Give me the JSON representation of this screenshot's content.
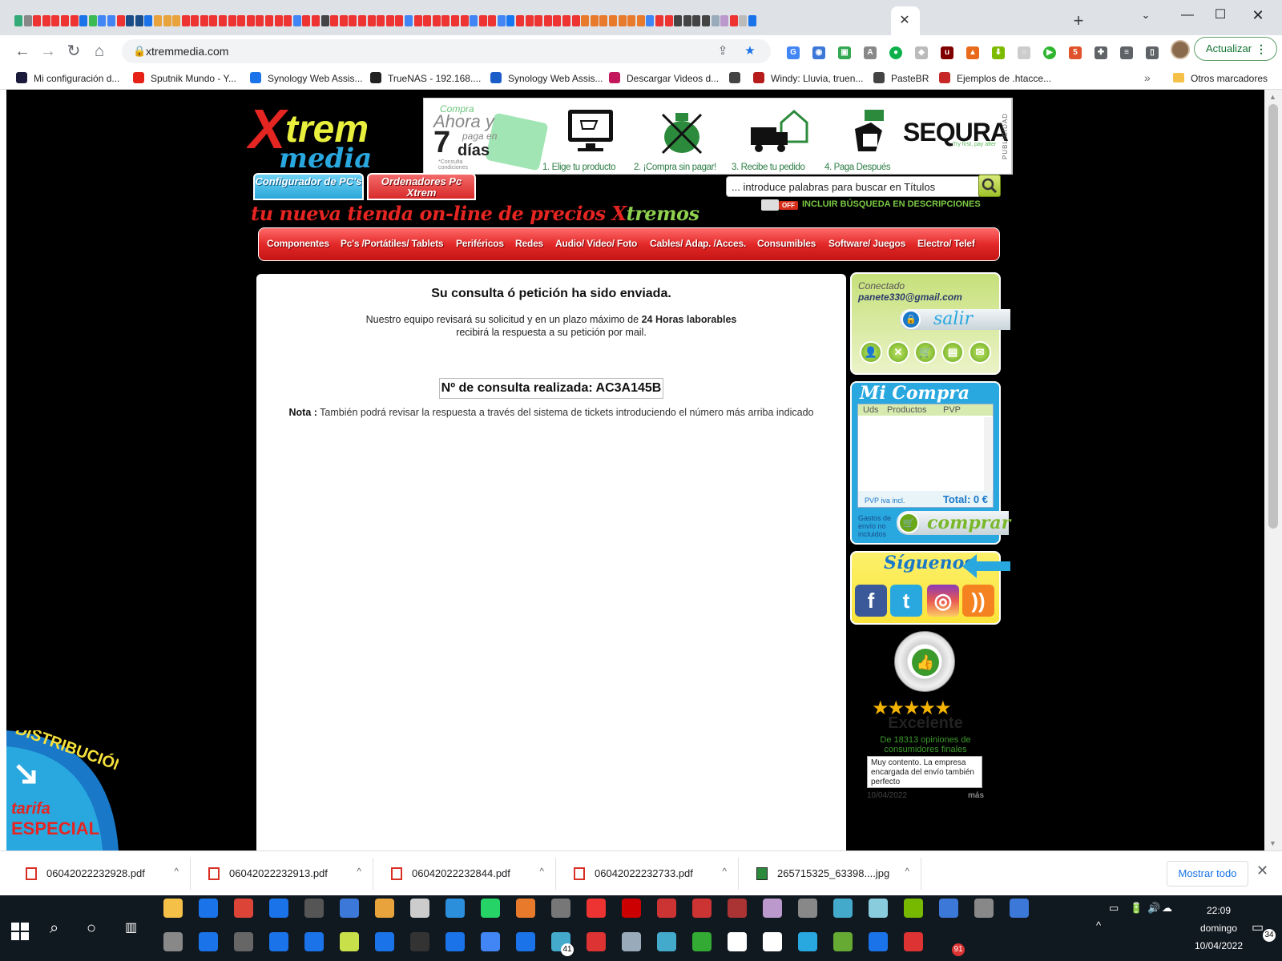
{
  "browser": {
    "tab_icon_colors": [
      "#3a7",
      "#888",
      "#e33",
      "#e33",
      "#e33",
      "#e33",
      "#e33",
      "#1a73e8",
      "#3cba54",
      "#4285f4",
      "#4285f4",
      "#e33",
      "#1a4c88",
      "#1a4c88",
      "#1a73e8",
      "#e8a33c",
      "#e8a33c",
      "#e8a33c",
      "#e33",
      "#e33",
      "#e33",
      "#e33",
      "#e33",
      "#e33",
      "#e33",
      "#e33",
      "#e33",
      "#e33",
      "#e33",
      "#e33",
      "#4285f4",
      "#e33",
      "#e33",
      "#444",
      "#e33",
      "#e33",
      "#e33",
      "#e33",
      "#e33",
      "#e33",
      "#e33",
      "#e33",
      "#4285f4",
      "#e33",
      "#e33",
      "#e33",
      "#e33",
      "#e33",
      "#e33",
      "#4285f4",
      "#e33",
      "#e33",
      "#4285f4",
      "#1877f2",
      "#e33",
      "#e33",
      "#e33",
      "#e33",
      "#e33",
      "#e33",
      "#e33",
      "#e87a2c",
      "#e87a2c",
      "#e87a2c",
      "#e87a2c",
      "#e87a2c",
      "#e87a2c",
      "#e87a2c",
      "#4285f4",
      "#e33",
      "#e33",
      "#444",
      "#444",
      "#444",
      "#444",
      "#9ab",
      "#b9c",
      "#e33",
      "#bbb",
      "#1a73e8"
    ],
    "url": "xtremmedia.com",
    "update_label": "Actualizar",
    "bookmarks": [
      {
        "label": "Mi configuración d...",
        "color": "#1a1a3a"
      },
      {
        "label": "Sputnik Mundo - Y...",
        "color": "#e62117"
      },
      {
        "label": "Synology Web Assis...",
        "color": "#1a73e8"
      },
      {
        "label": "TrueNAS - 192.168....",
        "color": "#222222"
      },
      {
        "label": "Synology Web Assis...",
        "color": "#1a5cc8"
      },
      {
        "label": "Descargar Videos d...",
        "color": "#c2185b"
      },
      {
        "label": "",
        "color": "#444444"
      },
      {
        "label": "Windy: Lluvia, truen...",
        "color": "#b71c1c"
      },
      {
        "label": "PasteBR",
        "color": "#444444"
      },
      {
        "label": "Ejemplos de .htacce...",
        "color": "#c62828"
      }
    ],
    "other_bookmarks": "Otros marcadores"
  },
  "site": {
    "logo_text_top": "Xtrem",
    "logo_text_bottom": "media",
    "ad": {
      "compra": "Compra",
      "ahora": "Ahora y",
      "paga": "paga en",
      "dias_num": "7",
      "dias": "días",
      "consulta": "*Consulta condiciones",
      "steps": [
        "1. Elige tu producto",
        "2. ¡Compra sin pagar!",
        "3. Recibe tu pedido",
        "4. Paga Después"
      ],
      "brand": "SEQURA",
      "brand_sub": "Try first, pay after",
      "publicidad": "PUBLICIDAD"
    },
    "btn_configurador": "Configurador de PC's",
    "btn_ordenadores": "Ordenadores Pc Xtrem",
    "slogan_main": "tu nueva tienda on-line de precios ",
    "slogan_x": "X",
    "slogan_tremos": "tremos",
    "search_placeholder": "... introduce palabras para buscar en Títulos",
    "toggle_state": "OFF",
    "toggle_label": "INCLUIR BÚSQUEDA EN DESCRIPCIONES",
    "nav": [
      "Componentes",
      "Pc's /Portátiles/ Tablets",
      "Periféricos",
      "Redes",
      "Audio/ Video/ Foto",
      "Cables/ Adap. /Acces.",
      "Consumibles",
      "Software/ Juegos",
      "Electro/ Telef"
    ]
  },
  "content": {
    "title": "Su consulta ó petición ha sido enviada.",
    "line1_pre": "Nuestro equipo revisará su solicitud y en un plazo máximo de ",
    "line1_bold": "24 Horas laborables",
    "line2": "recibirá la respuesta a su petición por mail.",
    "ticket": "Nº de consulta realizada: AC3A145B",
    "note_label": "Nota :",
    "note_text": " También podrá revisar la respuesta a través del sistema de tickets introduciendo el número más arriba indicado"
  },
  "sidebar": {
    "conectado": "Conectado",
    "email": "panete330@gmail.com",
    "salir": "salir",
    "cart_title": "Mi Compra",
    "cart_headers": [
      "Uds",
      "Productos",
      "PVP"
    ],
    "pvp_note": "PVP iva incl.",
    "total": "Total: 0 €",
    "gastos": "Gastos de envío no incluidos",
    "comprar": "comprar",
    "siguenos": "Síguenos",
    "ekomi": {
      "seal_text": "DISTINCIÓN DEL CLIENTE",
      "seal_brand": "eKomi",
      "rating": 4.5,
      "rating_label": "Excelente",
      "opinions": "De 18313 opiniones de consumidores finales",
      "review": "Muy contento. La empresa encargada del envío también perfecto",
      "date": "10/04/2022",
      "more": "más"
    },
    "dist_badge_top": "DISTRIBUCIÓN",
    "dist_badge_tarifa": "tarifa",
    "dist_badge_especial": "ESPECIAL"
  },
  "downloads": {
    "items": [
      {
        "name": "06042022232928.pdf",
        "type": "pdf"
      },
      {
        "name": "06042022232913.pdf",
        "type": "pdf"
      },
      {
        "name": "06042022232844.pdf",
        "type": "pdf"
      },
      {
        "name": "06042022232733.pdf",
        "type": "pdf"
      },
      {
        "name": "265715325_63398....jpg",
        "type": "jpg"
      }
    ],
    "show_all": "Mostrar todo"
  },
  "taskbar": {
    "time": "22:09",
    "day": "domingo",
    "date": "10/04/2022",
    "notifications": "34",
    "badge_41": "41",
    "badge_91": "91"
  }
}
